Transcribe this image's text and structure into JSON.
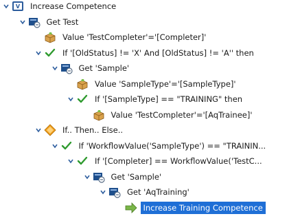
{
  "tree": {
    "rows": [
      {
        "label": "Increase Competence",
        "icon": "function-icon",
        "expanded": true,
        "level": 0
      },
      {
        "label": "Get Test",
        "icon": "get-record-icon",
        "expanded": true,
        "level": 1
      },
      {
        "label": "Value 'TestCompleter'='[Completer]'",
        "icon": "value-box-icon",
        "expanded": null,
        "level": 2
      },
      {
        "label": "If '[OldStatus]  != 'X'    And    [OldStatus]  != 'A'' then",
        "icon": "check-icon",
        "expanded": true,
        "level": 2
      },
      {
        "label": "Get 'Sample'",
        "icon": "get-record-icon",
        "expanded": true,
        "level": 3
      },
      {
        "label": "Value 'SampleType'='[SampleType]'",
        "icon": "value-box-icon",
        "expanded": null,
        "level": 4
      },
      {
        "label": "If '[SampleType]   ==  \"TRAINING\" then",
        "icon": "check-icon",
        "expanded": true,
        "level": 4
      },
      {
        "label": "Value 'TestCompleter'='[AqTrainee]'",
        "icon": "value-box-icon",
        "expanded": null,
        "level": 5
      },
      {
        "label": "If.. Then.. Else..",
        "icon": "diamond-icon",
        "expanded": true,
        "level": 2
      },
      {
        "label": "If 'WorkflowValue('SampleType')  ==  \"TRAININ...",
        "icon": "check-icon",
        "expanded": true,
        "level": 3
      },
      {
        "label": "If '[Completer]  ==  WorkflowValue('TestC...",
        "icon": "check-icon",
        "expanded": true,
        "level": 4
      },
      {
        "label": "Get 'Sample'",
        "icon": "get-record-icon",
        "expanded": true,
        "level": 5
      },
      {
        "label": "Get 'AqTraining'",
        "icon": "get-record-icon",
        "expanded": true,
        "level": 6
      },
      {
        "label": "Increase Training Competence",
        "icon": "call-arrow-icon",
        "expanded": null,
        "level": 7,
        "selected": true
      }
    ]
  },
  "colors": {
    "selection": "#1f6fd6",
    "check": "#2e9a2e",
    "chevron": "#2f5f9f",
    "record": "#1e4f8c",
    "diamond": "#f0a020",
    "arrow": "#7ab648"
  }
}
